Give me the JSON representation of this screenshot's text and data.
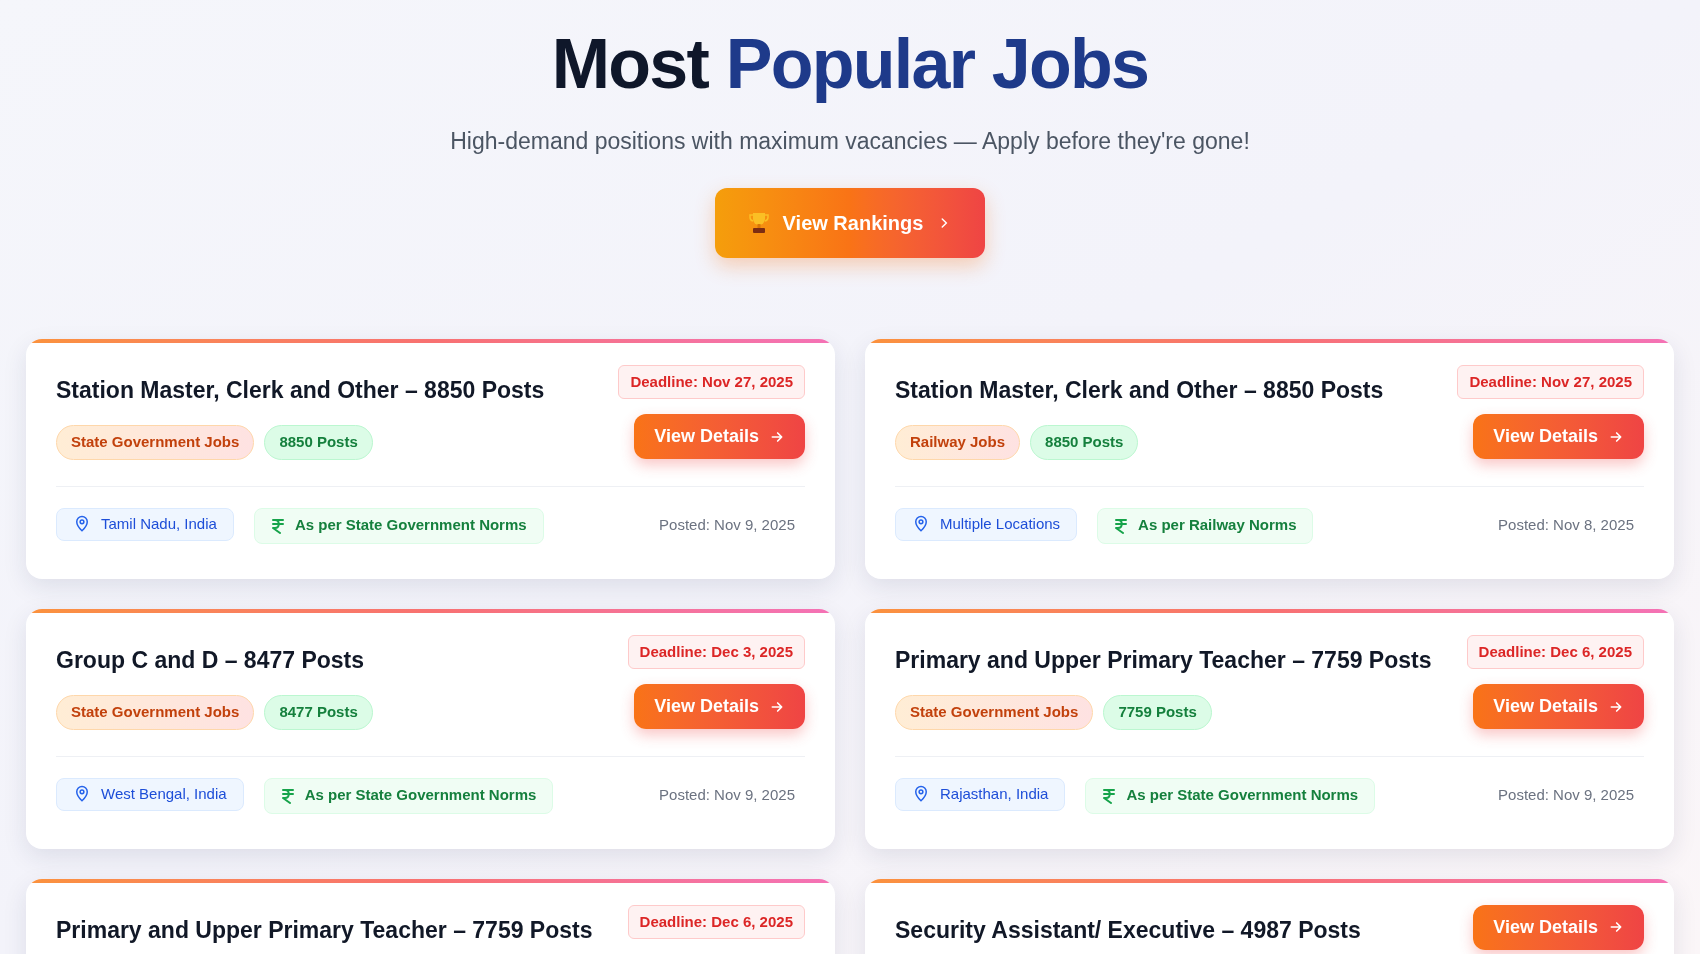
{
  "header": {
    "title_start": "Most",
    "title_end": "Popular Jobs",
    "subtitle": "High-demand positions with maximum vacancies — Apply before they're gone!",
    "button": {
      "label": "View Rankings"
    }
  },
  "jobs": [
    {
      "title": "Station Master, Clerk and Other – 8850 Posts",
      "deadline": "Deadline: Nov 27, 2025",
      "category": "State Government Jobs",
      "posts": "8850 Posts",
      "button": "View Details",
      "location": "Tamil Nadu, India",
      "salary": "As per State Government Norms",
      "posted": "Posted: Nov 9, 2025"
    },
    {
      "title": "Station Master, Clerk and Other – 8850 Posts",
      "deadline": "Deadline: Nov 27, 2025",
      "category": "Railway Jobs",
      "posts": "8850 Posts",
      "button": "View Details",
      "location": "Multiple Locations",
      "salary": "As per Railway Norms",
      "posted": "Posted: Nov 8, 2025"
    },
    {
      "title": "Group C and D – 8477 Posts",
      "deadline": "Deadline: Dec 3, 2025",
      "category": "State Government Jobs",
      "posts": "8477 Posts",
      "button": "View Details",
      "location": "West Bengal, India",
      "salary": "As per State Government Norms",
      "posted": "Posted: Nov 9, 2025"
    },
    {
      "title": "Primary and Upper Primary Teacher – 7759 Posts",
      "deadline": "Deadline: Dec 6, 2025",
      "category": "State Government Jobs",
      "posts": "7759 Posts",
      "button": "View Details",
      "location": "Rajasthan, India",
      "salary": "As per State Government Norms",
      "posted": "Posted: Nov 9, 2025"
    },
    {
      "title": "Primary and Upper Primary Teacher – 7759 Posts",
      "deadline": "Deadline: Dec 6, 2025"
    },
    {
      "title": "Security Assistant/ Executive – 4987 Posts",
      "button": "View Details"
    }
  ]
}
